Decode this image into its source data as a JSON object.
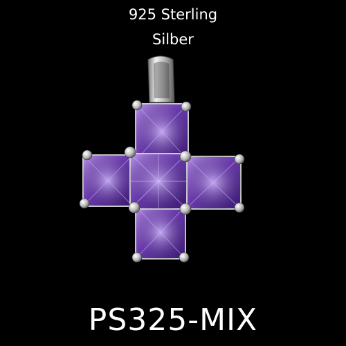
{
  "caption": {
    "line1": "925 Sterling",
    "line2": "Silber"
  },
  "product_code": "PS325-MIX",
  "colors": {
    "background": "#000000",
    "stone": "#8a5bc8",
    "silver": "#d8d8d8"
  }
}
